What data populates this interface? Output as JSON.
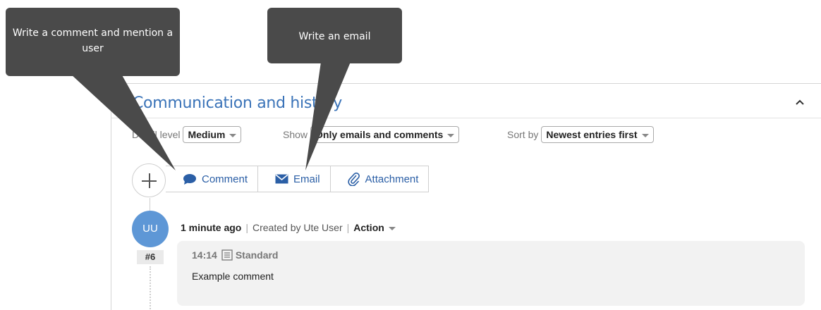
{
  "panel": {
    "title": "Communication and history"
  },
  "filters": {
    "detail_level": {
      "label": "Detail level",
      "value": "Medium"
    },
    "show": {
      "label": "Show",
      "value": "Only emails and comments"
    },
    "sort_by": {
      "label": "Sort by",
      "value": "Newest entries first"
    }
  },
  "toolbar": {
    "comment_label": "Comment",
    "email_label": "Email",
    "attachment_label": "Attachment"
  },
  "entry": {
    "avatar_initials": "UU",
    "number": "#6",
    "time_ago": "1 minute ago",
    "created_by": "Created by Ute User",
    "action_label": "Action",
    "timestamp": "14:14",
    "type": "Standard",
    "text": "Example comment"
  },
  "callouts": {
    "comment_hint": "Write a comment and mention a user",
    "email_hint": "Write an email"
  },
  "colors": {
    "accent": "#3a73b8",
    "avatar": "#5e97d6",
    "callout_bg": "#4a4a4a"
  }
}
